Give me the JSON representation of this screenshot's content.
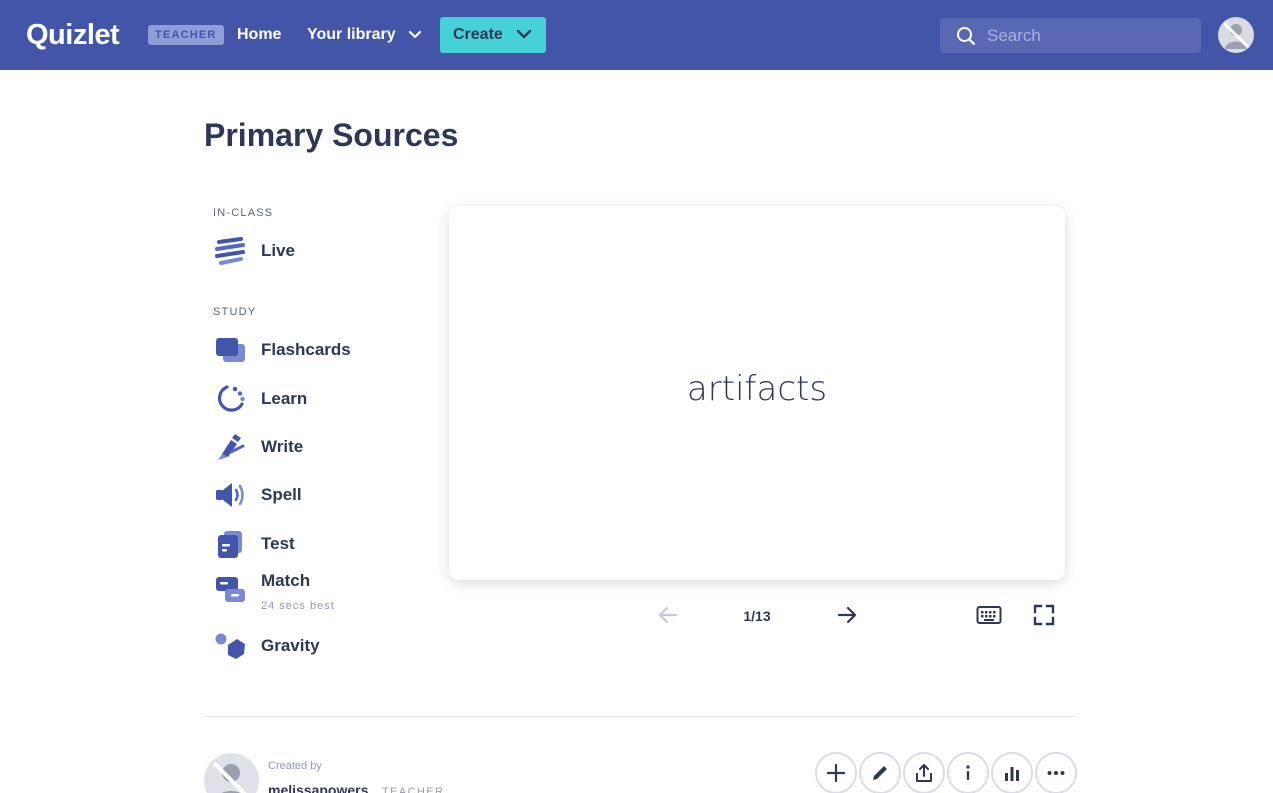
{
  "nav": {
    "logo": "Quizlet",
    "badge": "TEACHER",
    "home": "Home",
    "library": "Your library",
    "create": "Create",
    "search_placeholder": "Search"
  },
  "page": {
    "title": "Primary Sources"
  },
  "sidebar": {
    "in_class_label": "IN-CLASS",
    "study_label": "STUDY",
    "in_class": [
      {
        "label": "Live",
        "icon": "live-icon"
      }
    ],
    "study": [
      {
        "label": "Flashcards",
        "icon": "flashcards-icon"
      },
      {
        "label": "Learn",
        "icon": "learn-icon"
      },
      {
        "label": "Write",
        "icon": "write-icon"
      },
      {
        "label": "Spell",
        "icon": "spell-icon"
      },
      {
        "label": "Test",
        "icon": "test-icon"
      },
      {
        "label": "Match",
        "icon": "match-icon",
        "sub": "24 secs best"
      },
      {
        "label": "Gravity",
        "icon": "gravity-icon"
      }
    ]
  },
  "card": {
    "term": "artifacts",
    "counter": "1/13"
  },
  "author": {
    "created_by": "Created by",
    "name": "melissapowers",
    "badge": "TEACHER"
  },
  "actions": [
    "add-icon",
    "edit-icon",
    "share-icon",
    "info-icon",
    "stats-icon",
    "more-icon"
  ],
  "colors": {
    "nav_bg": "#4255a8",
    "create_bg": "#46d1d8",
    "icon_blue": "#4255a8",
    "text_dark": "#2e3856"
  }
}
